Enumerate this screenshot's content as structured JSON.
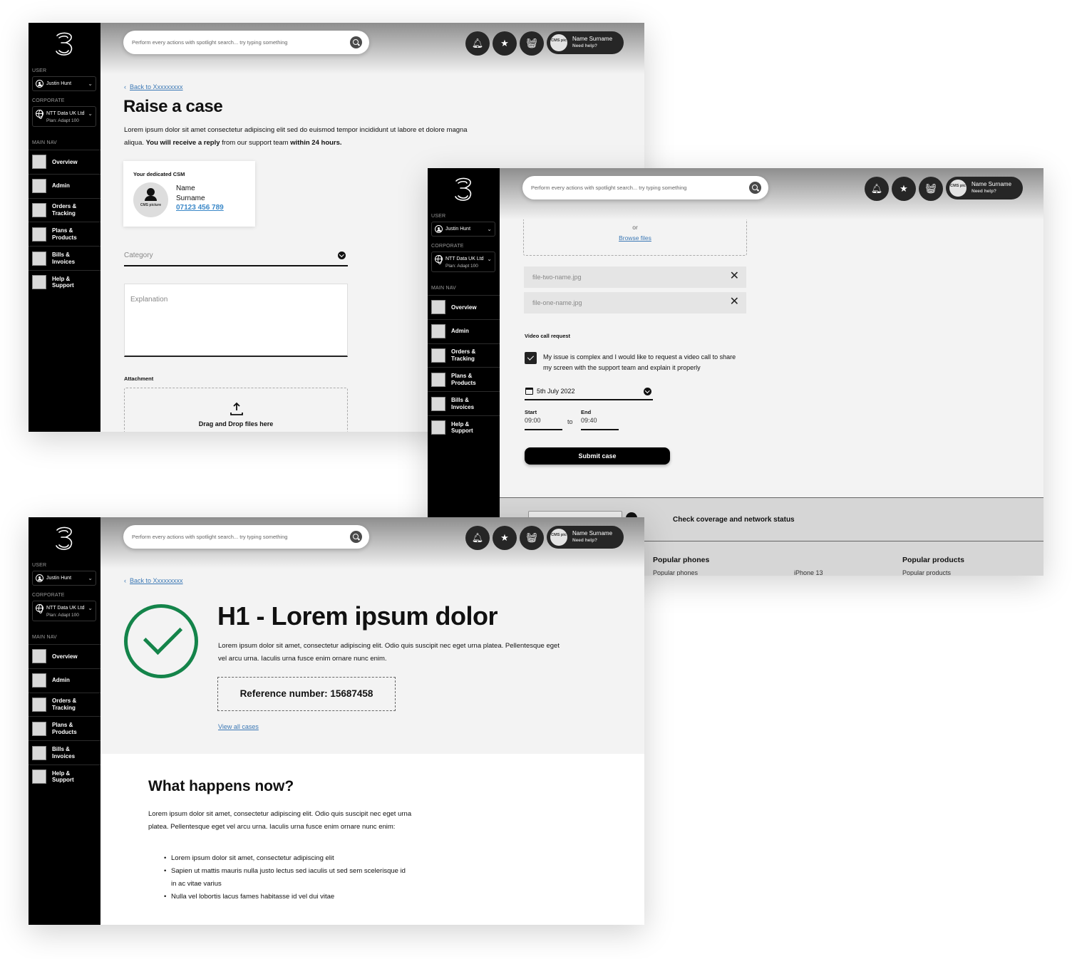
{
  "shared": {
    "sidebar": {
      "user_label": "USER",
      "user_name": "Justin Hunt",
      "corporate_label": "CORPORATE",
      "corporate_name": "NTT Data UK Ltd",
      "corporate_plan": "Plan: Adapt 100",
      "main_nav_label": "MAIN NAV",
      "nav_items": [
        {
          "label": "Overview"
        },
        {
          "label": "Admin"
        },
        {
          "label": "Orders &\nTracking"
        },
        {
          "label": "Plans &\nProducts"
        },
        {
          "label": "Bills &\nInvoices"
        },
        {
          "label": "Help &\nSupport"
        }
      ]
    },
    "header": {
      "search_placeholder": "Perform every actions with spotlight search... try typing something",
      "profile_pic": "CMS pic",
      "profile_name": "Name Surname",
      "profile_help": "Need help?"
    }
  },
  "raise_case": {
    "back_link": "Back to Xxxxxxxxx",
    "title": "Raise a case",
    "intro_plain_1": "Lorem ipsum dolor sit amet consectetur adipiscing elit sed do euismod tempor incididunt ut labore et dolore magna aliqua. ",
    "intro_bold_1": "You will receive a reply",
    "intro_plain_2": " from our support team ",
    "intro_bold_2": "within 24 hours.",
    "csm": {
      "title": "Your dedicated CSM",
      "picture_caption": "CMS picture",
      "name": "Name Surname",
      "phone": "07123 456 789"
    },
    "category_placeholder": "Category",
    "explanation_placeholder": "Explanation",
    "attachment_label": "Attachment",
    "drop_text": "Drag and Drop files here"
  },
  "raise_case_scrolled": {
    "drop_text": "Drag and Drop files here",
    "or_text": "or",
    "browse_link": "Browse files",
    "files": [
      {
        "name": "file-two-name.jpg"
      },
      {
        "name": "file-one-name.jpg"
      }
    ],
    "video_call_label": "Video call request",
    "video_call_checked": true,
    "video_call_text": "My issue is complex and I would like to request a video call to share my screen with the support team and explain it properly",
    "date_value": "5th July 2022",
    "start_label": "Start",
    "start_value": "09:00",
    "to_text": "to",
    "end_label": "End",
    "end_value": "09:40",
    "submit_label": "Submit case",
    "footer": {
      "coverage_text": "Check coverage and network status",
      "col1_heading": "Popular phones",
      "col1_item": "Popular phones",
      "col2_item": "iPhone 13",
      "col3_heading": "Popular products",
      "col3_item": "Popular products"
    }
  },
  "confirmation": {
    "back_link": "Back to Xxxxxxxxx",
    "title": "H1 - Lorem ipsum dolor",
    "intro": "Lorem ipsum dolor sit amet, consectetur adipiscing elit. Odio quis suscipit nec eget urna platea. Pellentesque eget vel arcu urna. Iaculis urna fusce enim ornare nunc enim.",
    "reference": "Reference number: 15687458",
    "view_all_link": "View all cases",
    "success_color": "#14844a",
    "next_heading": "What happens now?",
    "next_para": "Lorem ipsum dolor sit amet, consectetur adipiscing elit. Odio quis suscipit nec eget urna platea. Pellentesque eget vel arcu urna. Iaculis urna fusce enim ornare nunc enim:",
    "bullets": [
      "Lorem ipsum dolor sit amet, consectetur adipiscing elit",
      "Sapien ut mattis mauris nulla justo lectus sed iaculis ut sed sem scelerisque id in ac vitae varius",
      "Nulla vel lobortis lacus fames habitasse id vel dui vitae"
    ]
  }
}
